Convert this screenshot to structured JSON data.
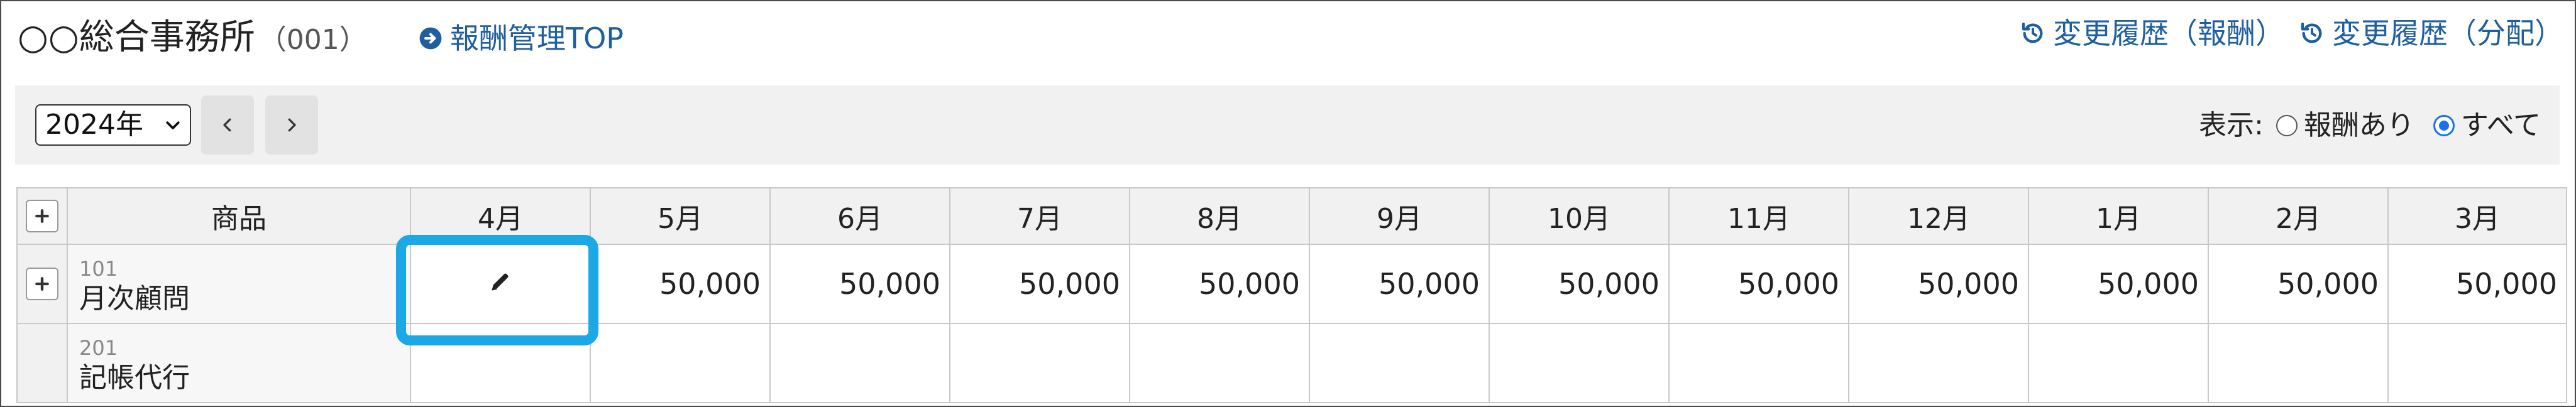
{
  "header": {
    "title": "○○総合事務所",
    "code": "（001）",
    "top_link": "報酬管理TOP",
    "history_fee": "変更履歴（報酬）",
    "history_alloc": "変更履歴（分配）"
  },
  "toolbar": {
    "year": "2024年",
    "prev_icon": "chevron-left-icon",
    "next_icon": "chevron-right-icon",
    "filter_label": "表示:",
    "filter_options": [
      "報酬あり",
      "すべて"
    ],
    "filter_selected": "すべて"
  },
  "table": {
    "headers": [
      "商品",
      "4月",
      "5月",
      "6月",
      "7月",
      "8月",
      "9月",
      "10月",
      "11月",
      "12月",
      "1月",
      "2月",
      "3月"
    ],
    "rows": [
      {
        "code": "101",
        "name": "月次顧問",
        "values": [
          "",
          "50,000",
          "50,000",
          "50,000",
          "50,000",
          "50,000",
          "50,000",
          "50,000",
          "50,000",
          "50,000",
          "50,000",
          "50,000"
        ]
      },
      {
        "code": "201",
        "name": "記帳代行",
        "values": [
          "",
          "",
          "",
          "",
          "",
          "",
          "",
          "",
          "",
          "",
          "",
          ""
        ]
      }
    ]
  },
  "colors": {
    "link": "#1f5fa0",
    "highlight": "#1aa9e6",
    "radio_selected": "#1a73e8"
  }
}
